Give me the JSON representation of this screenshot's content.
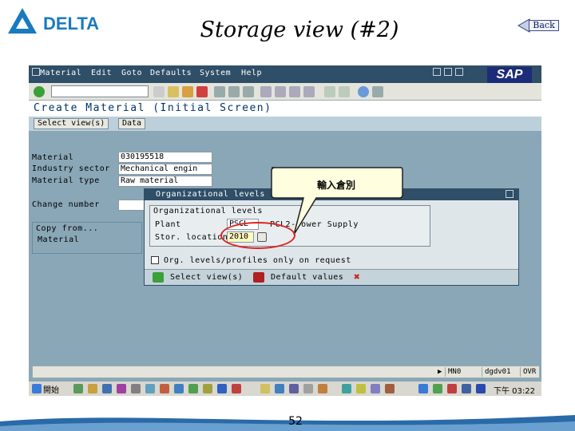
{
  "brand": {
    "logo_text": "DELTA"
  },
  "slide": {
    "title": "Storage view (#2)",
    "back_label": "Back",
    "page_number": "52"
  },
  "sap": {
    "logo_text": "SAP",
    "menu": [
      "Material",
      "Edit",
      "Goto",
      "Defaults",
      "System",
      "Help"
    ],
    "screen_title": "Create Material (Initial Screen)",
    "app_buttons": [
      "Select view(s)",
      "Data"
    ],
    "fields": {
      "material": {
        "label": "Material",
        "value": "030195518"
      },
      "industry_sector": {
        "label": "Industry sector",
        "value": "Mechanical engin"
      },
      "material_type": {
        "label": "Material type",
        "value": "Raw material"
      },
      "change_number": {
        "label": "Change number",
        "value": ""
      }
    },
    "copy_from": {
      "title": "Copy from...",
      "material_label": "Material"
    },
    "dialog": {
      "title": "Organizational levels",
      "group_title": "Organizational levels",
      "plant_label": "Plant",
      "plant_value": "PSCL",
      "plant_desc": "PCL2-Power Supply",
      "stor_label": "Stor. location",
      "stor_value": "2010",
      "checkbox_label": "Org. levels/profiles only on request",
      "select_view_button": "Select view(s)",
      "default_values_button": "Default values"
    },
    "status_bar": {
      "cells": [
        "MN0",
        "dgdv01",
        "OVR"
      ]
    }
  },
  "annotation": {
    "callout_text": "輸入倉別"
  },
  "taskbar": {
    "start_label": "開始",
    "clock": "下午 03:22"
  },
  "colors": {
    "sap_bg": "#8aa7b7",
    "menubar": "#2f4e67",
    "highlight": "#e02020"
  }
}
